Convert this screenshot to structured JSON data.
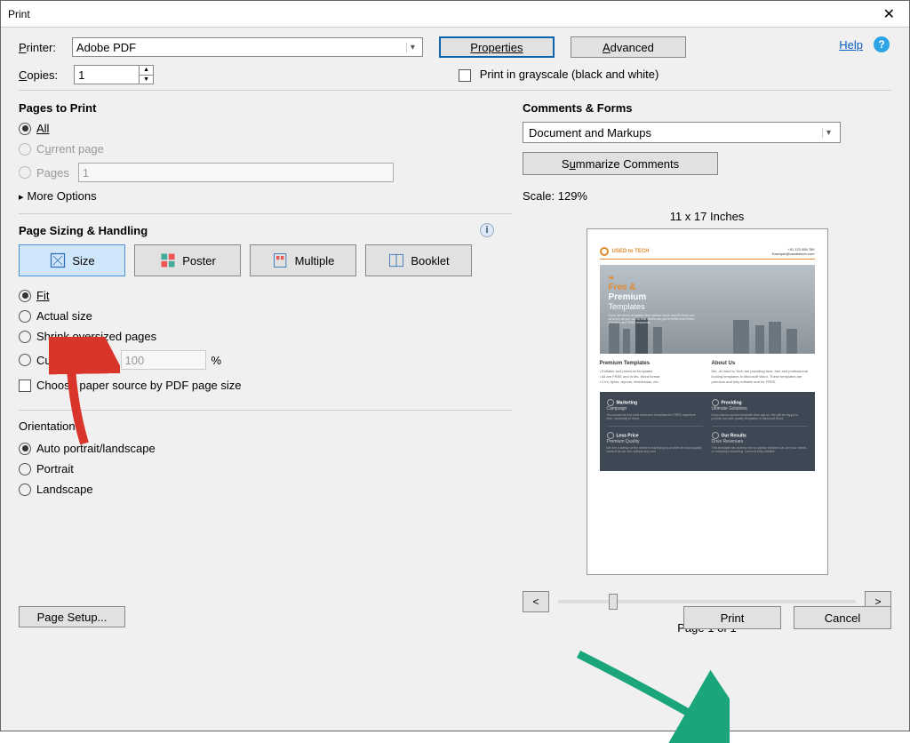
{
  "window_title": "Print",
  "printer": {
    "label": "Printer:",
    "value": "Adobe PDF"
  },
  "copies": {
    "label": "Copies:",
    "value": "1"
  },
  "buttons": {
    "properties": "Properties",
    "advanced": "Advanced",
    "help": "Help",
    "summarize": "Summarize Comments",
    "pagesetup": "Page Setup...",
    "print": "Print",
    "cancel": "Cancel",
    "prev": "<",
    "next": ">"
  },
  "grayscale_label": "Print in grayscale (black and white)",
  "pages_to_print": {
    "title": "Pages to Print",
    "all": "All",
    "current": "Current page",
    "pages": "Pages",
    "pages_value": "1",
    "more": "More Options"
  },
  "page_sizing": {
    "title": "Page Sizing & Handling",
    "size": "Size",
    "poster": "Poster",
    "multiple": "Multiple",
    "booklet": "Booklet",
    "fit": "Fit",
    "actual": "Actual size",
    "shrink": "Shrink oversized pages",
    "custom": "Custom Scale:",
    "custom_value": "100",
    "percent": "%",
    "choose_source": "Choose paper source by PDF page size"
  },
  "orientation": {
    "title": "Orientation:",
    "auto": "Auto portrait/landscape",
    "portrait": "Portrait",
    "landscape": "Landscape"
  },
  "comments_forms": {
    "title": "Comments & Forms",
    "value": "Document and Markups"
  },
  "preview": {
    "scale": "Scale: 129%",
    "dims": "11 x 17 Inches",
    "page_of": "Page 1 of 1",
    "doc": {
      "brand": "USED to TECH",
      "hero_free": "Free &",
      "hero_prem": "Premium",
      "hero_tmpl": "Templates",
      "col1_h": "Premium Templates",
      "col2_h": "About Us",
      "d1a": "Marketing",
      "d1b": "Campaign",
      "d2a": "Providing",
      "d2b": "Ultimate Solutions",
      "d3a": "Less Price",
      "d3b": "Premium Quality",
      "d4a": "Our Results",
      "d4b": "Drive Revenues"
    }
  }
}
